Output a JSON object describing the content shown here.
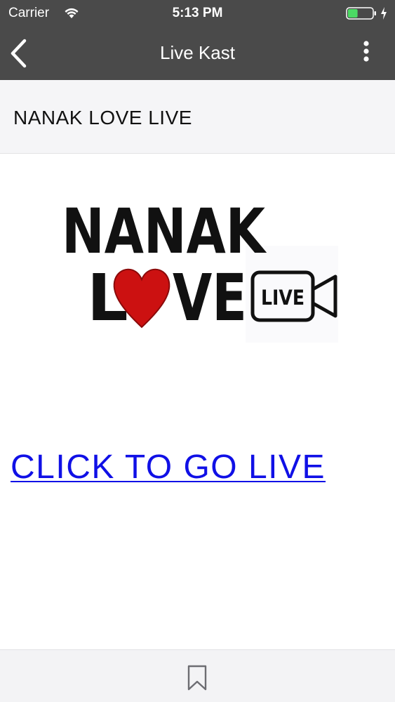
{
  "status_bar": {
    "carrier": "Carrier",
    "time": "5:13 PM",
    "battery_level": 0.4
  },
  "nav": {
    "title": "Live Kast"
  },
  "section": {
    "title": "NANAK LOVE LIVE"
  },
  "logo": {
    "line1": "NANAK",
    "line2_left": "L",
    "line2_right": "VE",
    "badge": "LIVE"
  },
  "main": {
    "link_label": "CLICK TO GO LIVE"
  },
  "colors": {
    "bar": "#4a4a4a",
    "link": "#1010e6",
    "heart": "#cc1111",
    "battery": "#4cd964"
  }
}
